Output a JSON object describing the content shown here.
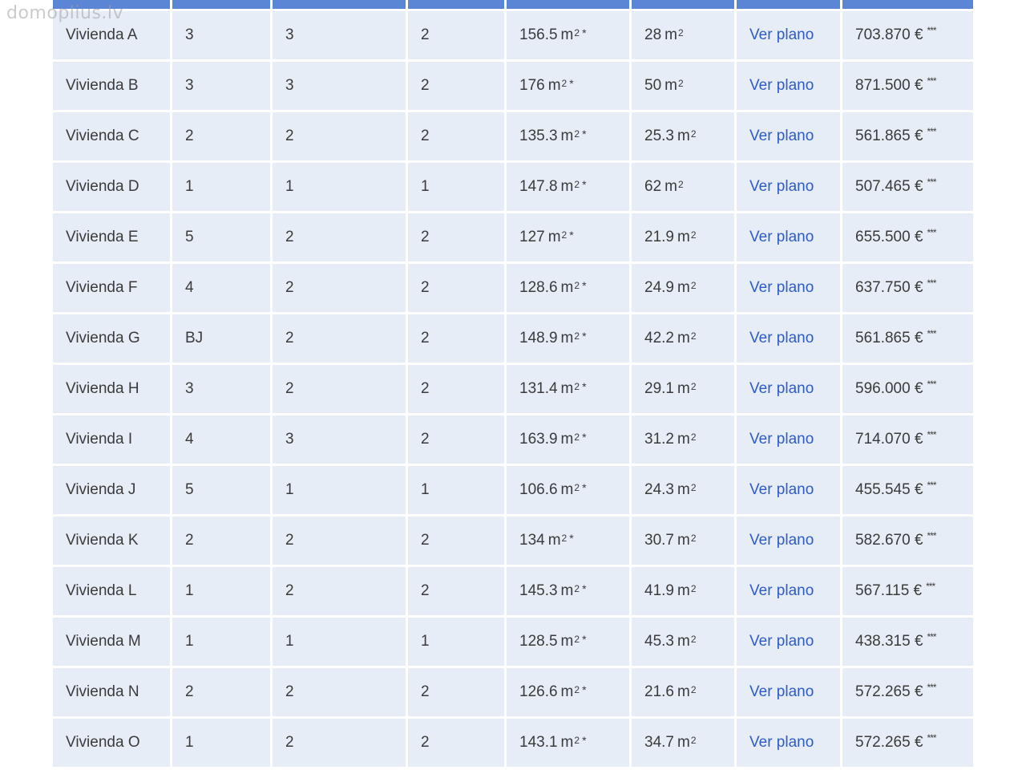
{
  "watermark": "domoplius.lv",
  "rows": [
    {
      "name": "Vivienda A",
      "floor": "3",
      "rooms": "3",
      "baths": "2",
      "area": "156.5",
      "terrace": "28",
      "plan": "Ver plano",
      "price": "703.870 €"
    },
    {
      "name": "Vivienda B",
      "floor": "3",
      "rooms": "3",
      "baths": "2",
      "area": "176",
      "terrace": "50",
      "plan": "Ver plano",
      "price": "871.500 €"
    },
    {
      "name": "Vivienda C",
      "floor": "2",
      "rooms": "2",
      "baths": "2",
      "area": "135.3",
      "terrace": "25.3",
      "plan": "Ver plano",
      "price": "561.865 €"
    },
    {
      "name": "Vivienda D",
      "floor": "1",
      "rooms": "1",
      "baths": "1",
      "area": "147.8",
      "terrace": "62",
      "plan": "Ver plano",
      "price": "507.465 €"
    },
    {
      "name": "Vivienda E",
      "floor": "5",
      "rooms": "2",
      "baths": "2",
      "area": "127",
      "terrace": "21.9",
      "plan": "Ver plano",
      "price": "655.500 €"
    },
    {
      "name": "Vivienda F",
      "floor": "4",
      "rooms": "2",
      "baths": "2",
      "area": "128.6",
      "terrace": "24.9",
      "plan": "Ver plano",
      "price": "637.750 €"
    },
    {
      "name": "Vivienda G",
      "floor": "BJ",
      "rooms": "2",
      "baths": "2",
      "area": "148.9",
      "terrace": "42.2",
      "plan": "Ver plano",
      "price": "561.865 €"
    },
    {
      "name": "Vivienda H",
      "floor": "3",
      "rooms": "2",
      "baths": "2",
      "area": "131.4",
      "terrace": "29.1",
      "plan": "Ver plano",
      "price": "596.000 €"
    },
    {
      "name": "Vivienda I",
      "floor": "4",
      "rooms": "3",
      "baths": "2",
      "area": "163.9",
      "terrace": "31.2",
      "plan": "Ver plano",
      "price": "714.070 €"
    },
    {
      "name": "Vivienda J",
      "floor": "5",
      "rooms": "1",
      "baths": "1",
      "area": "106.6",
      "terrace": "24.3",
      "plan": "Ver plano",
      "price": "455.545 €"
    },
    {
      "name": "Vivienda K",
      "floor": "2",
      "rooms": "2",
      "baths": "2",
      "area": "134",
      "terrace": "30.7",
      "plan": "Ver plano",
      "price": "582.670 €"
    },
    {
      "name": "Vivienda L",
      "floor": "1",
      "rooms": "2",
      "baths": "2",
      "area": "145.3",
      "terrace": "41.9",
      "plan": "Ver plano",
      "price": "567.115 €"
    },
    {
      "name": "Vivienda M",
      "floor": "1",
      "rooms": "1",
      "baths": "1",
      "area": "128.5",
      "terrace": "45.3",
      "plan": "Ver plano",
      "price": "438.315 €"
    },
    {
      "name": "Vivienda N",
      "floor": "2",
      "rooms": "2",
      "baths": "2",
      "area": "126.6",
      "terrace": "21.6",
      "plan": "Ver plano",
      "price": "572.265 €"
    },
    {
      "name": "Vivienda O",
      "floor": "1",
      "rooms": "2",
      "baths": "2",
      "area": "143.1",
      "terrace": "34.7",
      "plan": "Ver plano",
      "price": "572.265 €"
    }
  ],
  "units": {
    "area_unit": "m",
    "area_exp": "2",
    "area_mark": "*",
    "price_mark": "***"
  },
  "colors": {
    "header": "#5b86d6",
    "row_bg": "#e6edf7",
    "link": "#2f5bc4",
    "text": "#3b3b3b"
  }
}
